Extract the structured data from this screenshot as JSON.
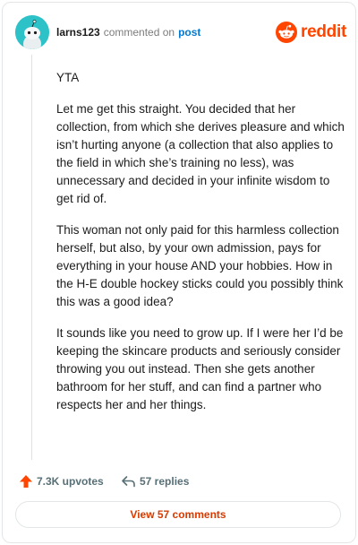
{
  "header": {
    "username": "larns123",
    "action_text": "commented on",
    "post_link": "post",
    "logo_text": "reddit"
  },
  "comment": {
    "paragraphs": [
      "YTA",
      "Let me get this straight. You decided that her collection, from which she derives pleasure and which isn’t hurting anyone (a collection that also applies to the field in which she’s training no less), was unnecessary and decided in your infinite wisdom to get rid of.",
      "This woman not only paid for this harmless collection herself, but also, by your own admission, pays for everything in your house AND your hobbies. How in the H-E double hockey sticks could you possibly think this was a good idea?",
      "It sounds like you need to grow up. If I were her I’d be keeping the skincare products and seriously consider throwing you out instead. Then she gets another bathroom for her stuff, and can find a partner who respects her and her things."
    ]
  },
  "footer": {
    "upvotes": "7.3K upvotes",
    "replies": "57 replies",
    "view_button": "View 57 comments"
  },
  "colors": {
    "brand": "#ff4500",
    "link": "#0079d3",
    "avatar_bg": "#2cc2c8",
    "button_text": "#d93a00"
  },
  "icons": {
    "avatar": "snoo-avatar-icon",
    "logo": "reddit-logo-icon",
    "upvote": "upvote-arrow-icon",
    "reply": "reply-arrow-icon"
  }
}
